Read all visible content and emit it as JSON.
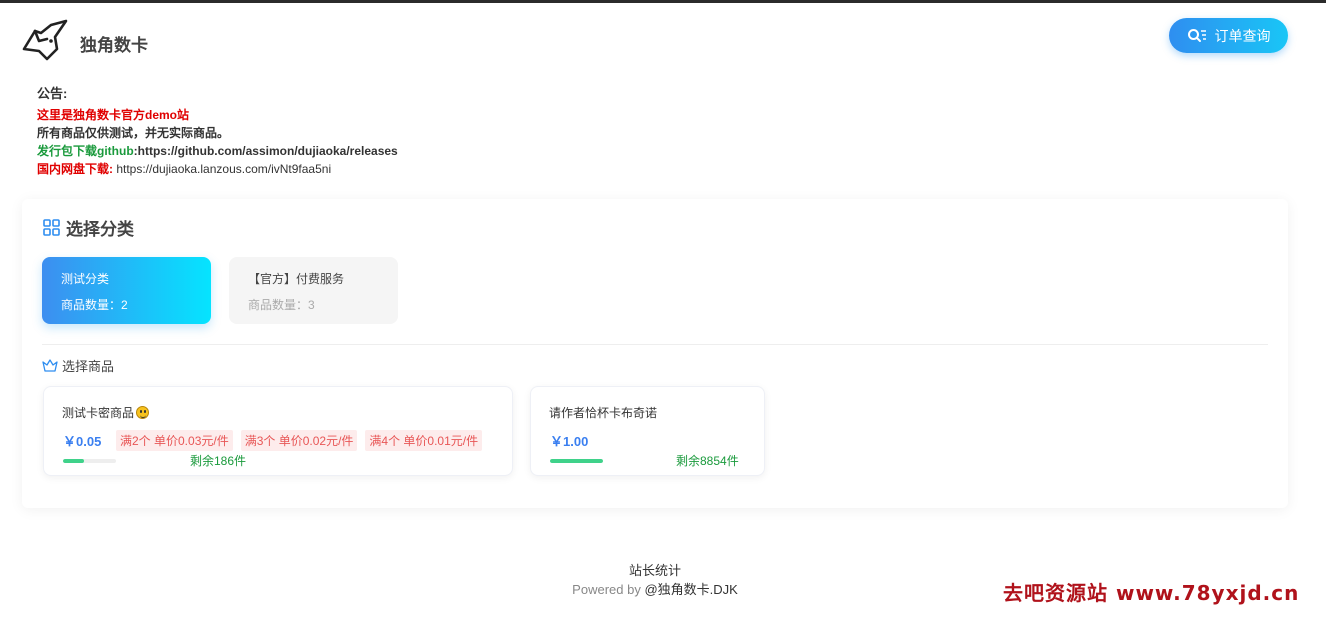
{
  "header": {
    "brand": "独角数卡",
    "order_query_label": "订单查询"
  },
  "notice": {
    "title": "公告:",
    "line1": "这里是独角数卡官方demo站",
    "line2": "所有商品仅供测试，并无实际商品。",
    "line3_label": "发行包下载github",
    "line3_value": ":https://github.com/assimon/dujiaoka/releases",
    "line4_label": "国内网盘下载:",
    "line4_value": " https://dujiaoka.lanzous.com/ivNt9faa5ni"
  },
  "categories": {
    "title": "选择分类",
    "items": [
      {
        "name": "测试分类",
        "count": "商品数量：2",
        "active": true
      },
      {
        "name": "【官方】付费服务",
        "count": "商品数量：3",
        "active": false
      }
    ]
  },
  "products": {
    "title": "选择商品",
    "items": [
      {
        "name": "测试卡密商品",
        "price": "￥0.05",
        "tags": [
          "满2个 单价0.03元/件",
          "满3个 单价0.02元/件",
          "满4个 单价0.01元/件"
        ],
        "stock": "剩余186件",
        "stock_fraction": 0.4
      },
      {
        "name": "请作者恰杯卡布奇诺",
        "price": "￥1.00",
        "tags": [],
        "stock": "剩余8854件",
        "stock_fraction": 1.0
      }
    ]
  },
  "footer": {
    "stats": "站长统计",
    "powered_prefix": "Powered by ",
    "powered_brand": "@独角数卡.DJK"
  },
  "watermark": "去吧资源站 www.78yxjd.cn",
  "colors": {
    "accent": "#2f8ef0",
    "price": "#3a7ff0",
    "stock_green": "#1a9a3c",
    "notice_red": "#e00000"
  }
}
